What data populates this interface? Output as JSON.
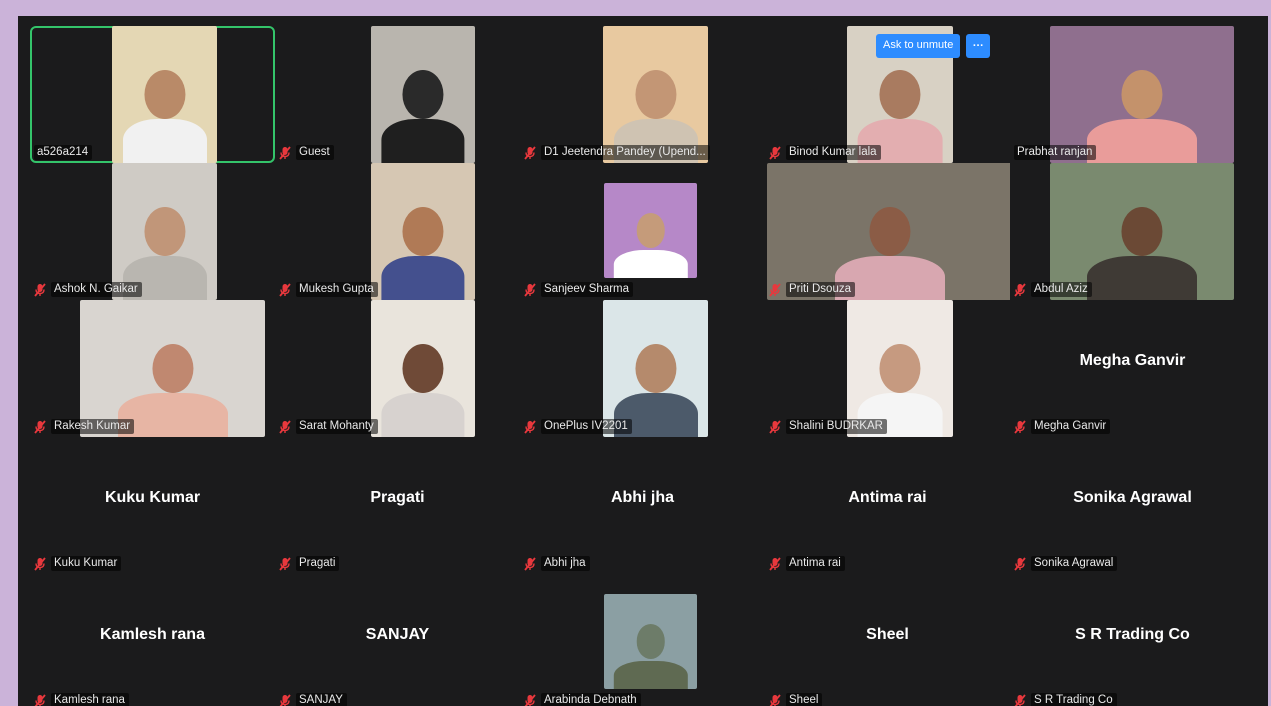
{
  "meeting": {
    "ask_to_unmute_label": "Ask to unmute",
    "more_label": "···"
  },
  "participants": [
    {
      "name": "a526a214",
      "muted": false,
      "video": true,
      "active_speaker": true
    },
    {
      "name": "Guest",
      "muted": true,
      "video": true
    },
    {
      "name": "D1 Jeetendra Pandey (Upend...",
      "muted": true,
      "video": true
    },
    {
      "name": "Binod Kumar lala",
      "muted": true,
      "video": true
    },
    {
      "name": "Prabhat ranjan",
      "muted": false,
      "video": true
    },
    {
      "name": "Ashok N. Gaikar",
      "muted": true,
      "video": true
    },
    {
      "name": "Mukesh Gupta",
      "muted": true,
      "video": true
    },
    {
      "name": "Sanjeev Sharma",
      "muted": true,
      "video": true
    },
    {
      "name": "Priti Dsouza",
      "muted": true,
      "video": true
    },
    {
      "name": "Abdul Aziz",
      "muted": true,
      "video": true
    },
    {
      "name": "Rakesh Kumar",
      "muted": true,
      "video": true
    },
    {
      "name": "Sarat Mohanty",
      "muted": true,
      "video": true
    },
    {
      "name": "OnePlus IV2201",
      "muted": true,
      "video": true
    },
    {
      "name": "Shalini BUDRKAR",
      "muted": true,
      "video": true
    },
    {
      "name": "Megha Ganvir",
      "muted": true,
      "video": false
    },
    {
      "name": "Kuku Kumar",
      "muted": true,
      "video": false
    },
    {
      "name": "Pragati",
      "muted": true,
      "video": false
    },
    {
      "name": "Abhi jha",
      "muted": true,
      "video": false
    },
    {
      "name": "Antima rai",
      "muted": true,
      "video": false
    },
    {
      "name": "Sonika Agrawal",
      "muted": true,
      "video": false
    },
    {
      "name": "Kamlesh rana",
      "muted": true,
      "video": false
    },
    {
      "name": "SANJAY",
      "muted": true,
      "video": false
    },
    {
      "name": "Arabinda Debnath",
      "muted": true,
      "video": true
    },
    {
      "name": "Sheel",
      "muted": true,
      "video": false
    },
    {
      "name": "S R Trading Co",
      "muted": true,
      "video": false
    }
  ],
  "colors": {
    "background": "#cbb3d9",
    "stage": "#1b1b1c",
    "active_speaker": "#34c46a",
    "muted_icon": "#e8383d",
    "unmute_button": "#2d8cff"
  }
}
